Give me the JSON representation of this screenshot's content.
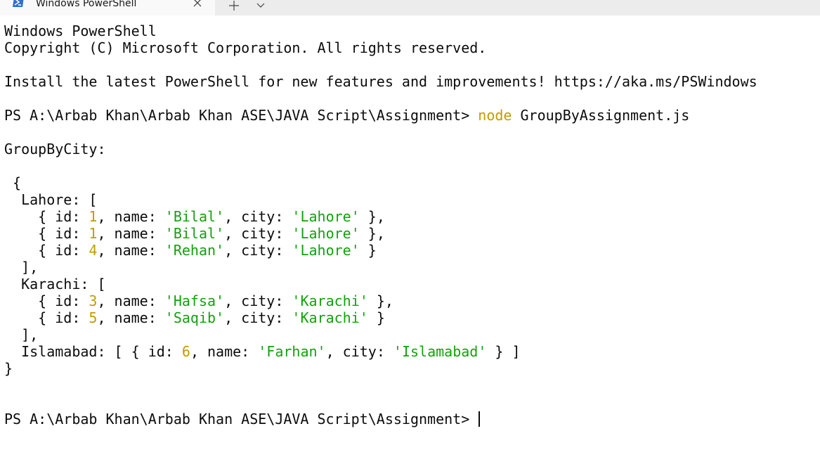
{
  "tab": {
    "title": "Windows PowerShell",
    "icon": "powershell-icon",
    "close_icon": "close-icon",
    "new_tab_icon": "plus-icon",
    "dropdown_icon": "chevron-down-icon"
  },
  "colors": {
    "number": "#c19c00",
    "string": "#13a10e",
    "command": "#c19c00",
    "text": "#0c0c0c",
    "background": "#ffffff"
  },
  "terminal": {
    "header": [
      "Windows PowerShell",
      "Copyright (C) Microsoft Corporation. All rights reserved."
    ],
    "install_message": "Install the latest PowerShell for new features and improvements! https://aka.ms/PSWindows",
    "prompt": "PS A:\\Arbab Khan\\Arbab Khan ASE\\JAVA Script\\Assignment> ",
    "command": "node",
    "command_arg": " GroupByAssignment.js",
    "output_label": "GroupByCity:",
    "open_brace": " {",
    "close_brace": "}",
    "groups": [
      {
        "city_key": "Lahore",
        "items": [
          {
            "id": "1",
            "name": "'Bilal'",
            "city": "'Lahore'"
          },
          {
            "id": "1",
            "name": "'Bilal'",
            "city": "'Lahore'"
          },
          {
            "id": "4",
            "name": "'Rehan'",
            "city": "'Lahore'"
          }
        ]
      },
      {
        "city_key": "Karachi",
        "items": [
          {
            "id": "3",
            "name": "'Hafsa'",
            "city": "'Karachi'"
          },
          {
            "id": "5",
            "name": "'Saqib'",
            "city": "'Karachi'"
          }
        ]
      },
      {
        "city_key": "Islamabad",
        "items": [
          {
            "id": "6",
            "name": "'Farhan'",
            "city": "'Islamabad'"
          }
        ]
      }
    ]
  }
}
